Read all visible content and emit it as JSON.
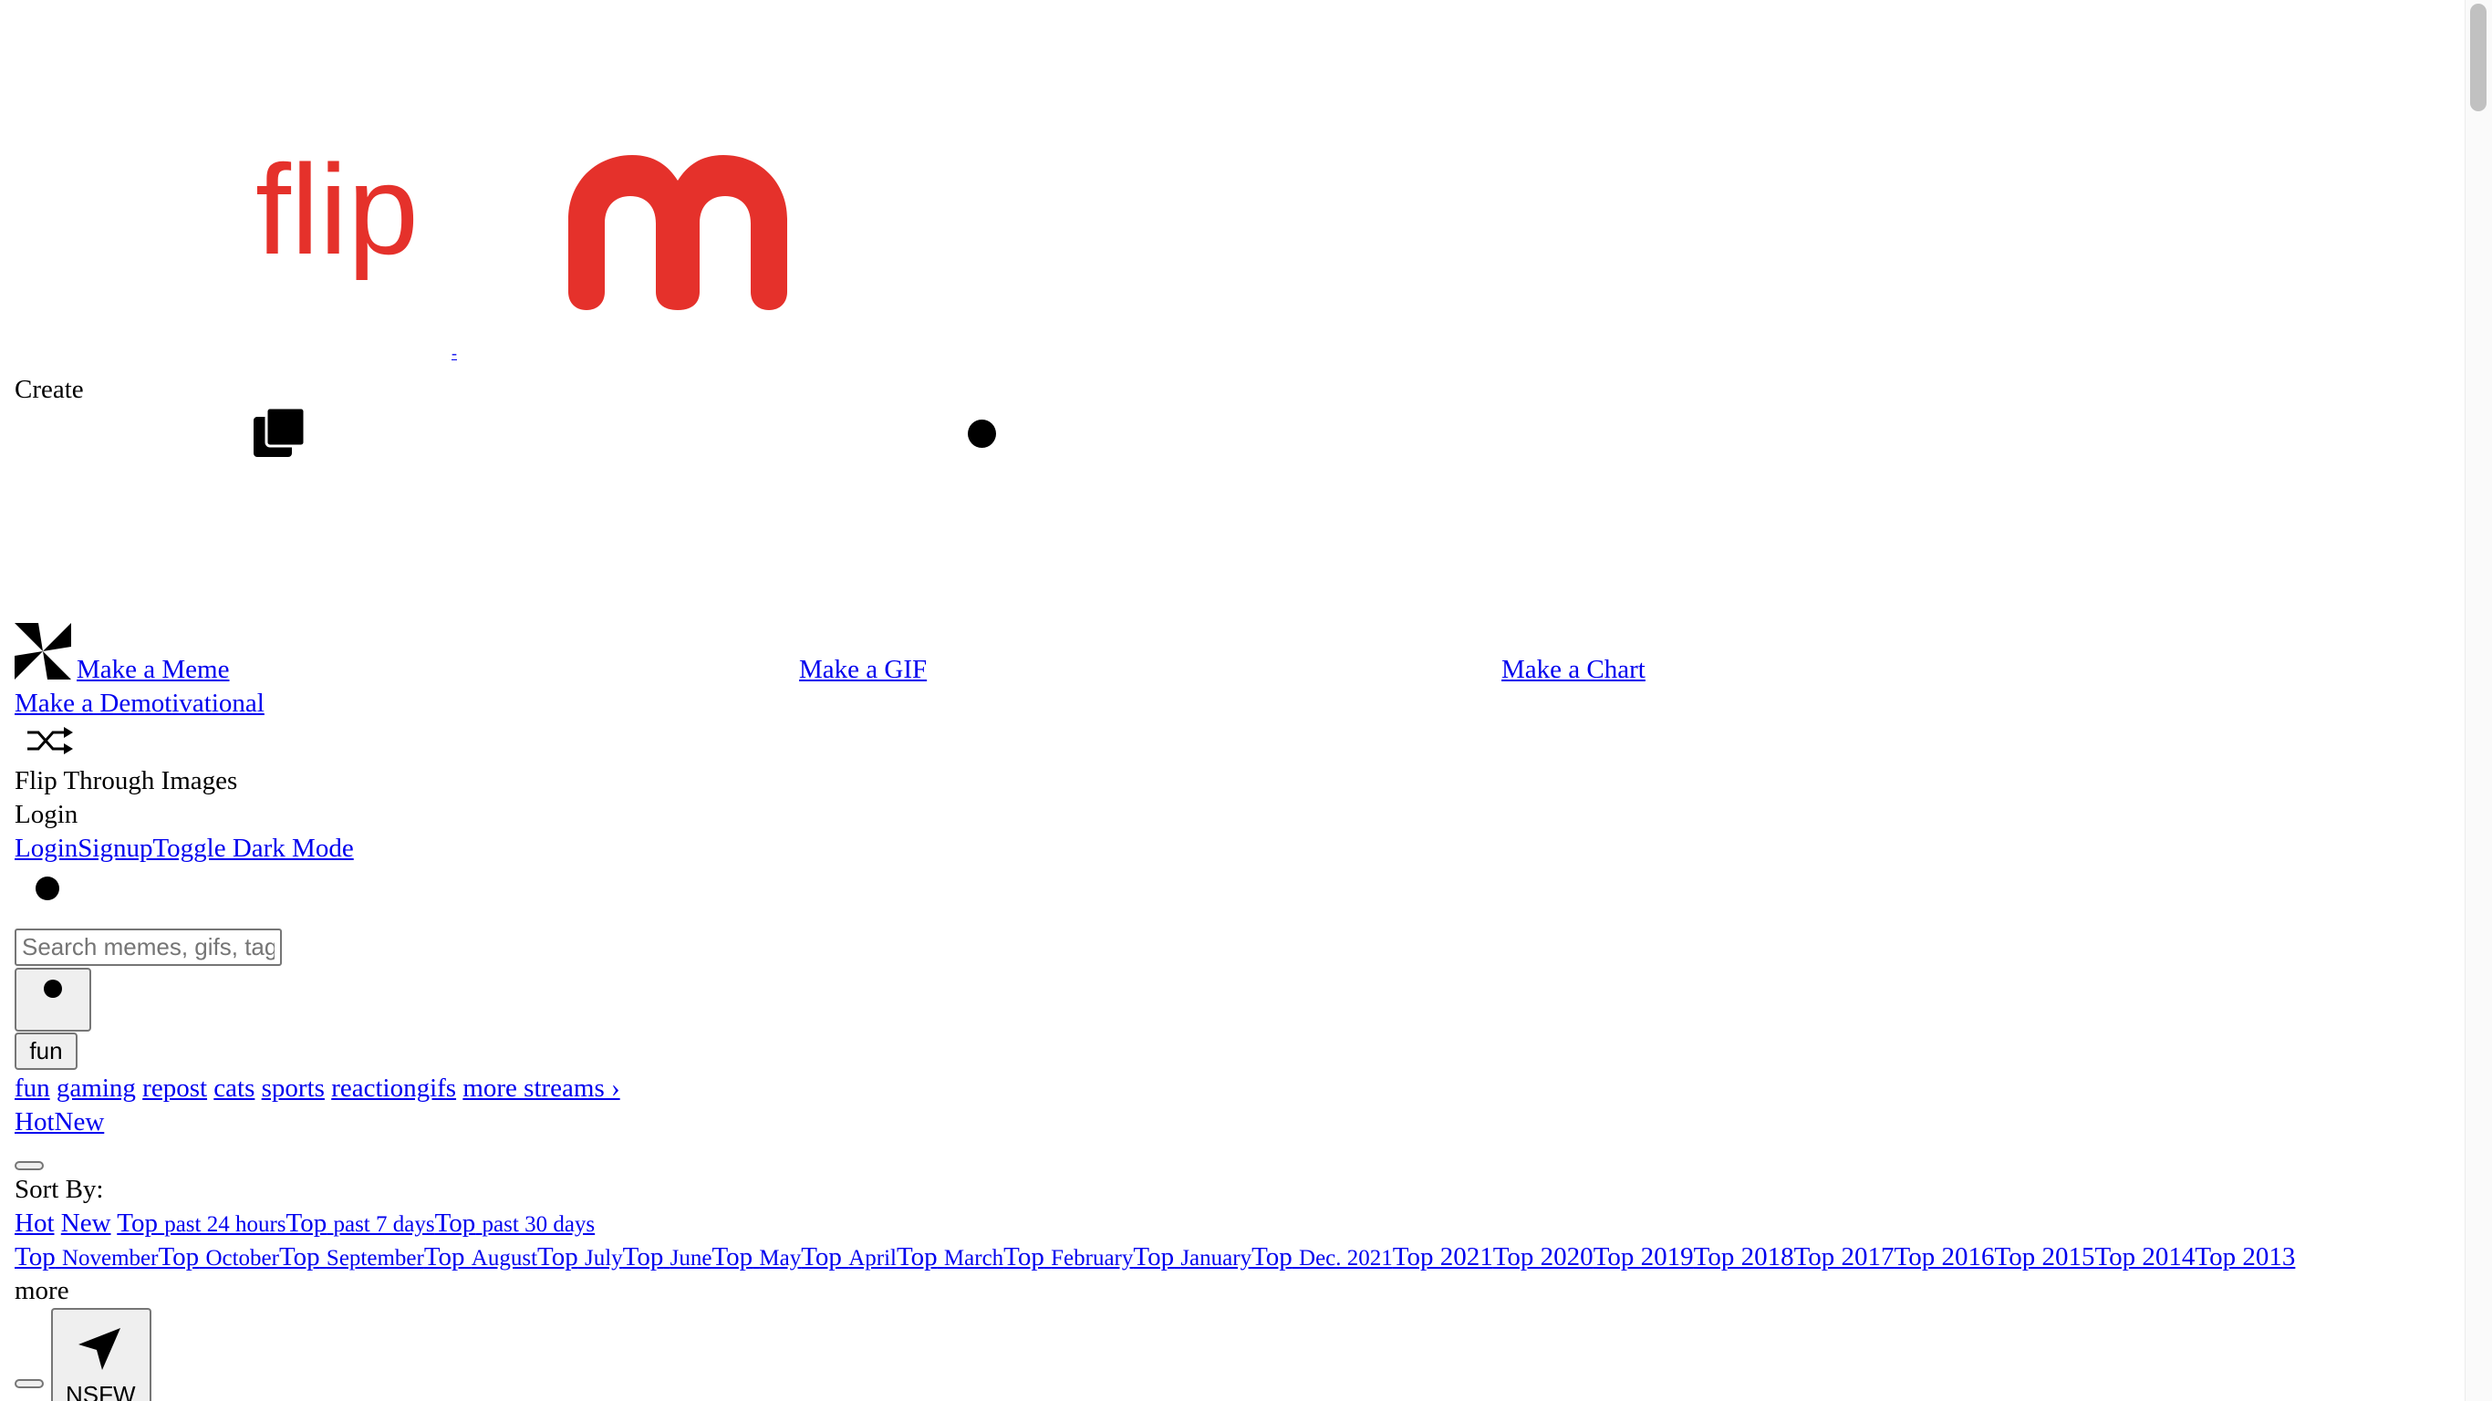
{
  "logo": {
    "flip_text": "flip",
    "alt_link": "-"
  },
  "header": {
    "create_label": "Create"
  },
  "create_menu": {
    "make_meme": "Make a Meme ",
    "make_gif": " Make a GIF ",
    "make_chart": " Make a Chart",
    "make_demotivational": "Make a Demotivational",
    "flip_through": "Flip Through Images"
  },
  "account": {
    "login_heading": "Login",
    "login_link": "Login",
    "signup_link": "Signup",
    "dark_mode_link": "Toggle Dark Mode"
  },
  "search": {
    "placeholder": "Search memes, gifs, tags"
  },
  "stream_select": {
    "value": "fun"
  },
  "streams": {
    "items": [
      "fun",
      "gaming",
      "repost",
      "cats",
      "sports",
      "reactiongifs"
    ],
    "more": "more streams ›"
  },
  "tabs": {
    "hot": "Hot",
    "new": "New"
  },
  "sort": {
    "label": "Sort By:",
    "hot": "Hot",
    "new": "New",
    "top_24h_top": "Top",
    "top_24h_sub": "past 24 hours",
    "top_7d_top": "Top",
    "top_7d_sub": "past 7 days",
    "top_30d_top": "Top",
    "top_30d_sub": "past 30 days",
    "months": [
      {
        "top": "Top",
        "sub": "November"
      },
      {
        "top": "Top",
        "sub": "October"
      },
      {
        "top": "Top",
        "sub": "September"
      },
      {
        "top": "Top",
        "sub": "August"
      },
      {
        "top": "Top",
        "sub": "July"
      },
      {
        "top": "Top",
        "sub": "June"
      },
      {
        "top": "Top",
        "sub": "May"
      },
      {
        "top": "Top",
        "sub": "April"
      },
      {
        "top": "Top",
        "sub": "March"
      },
      {
        "top": "Top",
        "sub": "February"
      },
      {
        "top": "Top",
        "sub": "January"
      },
      {
        "top": "Top",
        "sub": "Dec. 2021"
      }
    ],
    "years": [
      "Top 2021",
      "Top 2020",
      "Top 2019",
      "Top 2018",
      "Top 2017",
      "Top 2016",
      "Top 2015",
      "Top 2014",
      "Top 2013"
    ],
    "more": "more"
  },
  "nsfw": {
    "label": "NSFW"
  },
  "icons": {
    "pinwheel": "pinwheel-icon",
    "stack": "stack-icon",
    "dot": "dot-icon",
    "shuffle": "shuffle-icon",
    "arrow": "cursor-arrow-icon"
  },
  "colors": {
    "brand_red": "#e5312b",
    "link_blue": "#0000ee"
  }
}
